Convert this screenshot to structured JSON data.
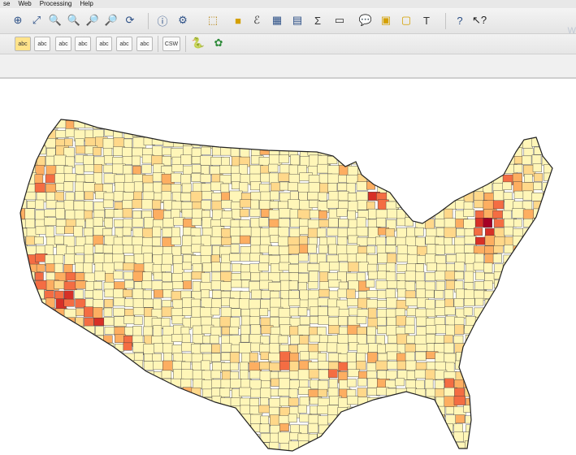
{
  "menu": {
    "items": [
      "se",
      "Web",
      "Processing",
      "Help"
    ]
  },
  "toolbar_main": {
    "buttons": [
      "zoom-1-1-icon",
      "zoom-full-icon",
      "zoom-in-icon",
      "zoom-out-icon",
      "zoom-layer-icon",
      "refresh-icon",
      "identify-icon",
      "pan-icon",
      "select-icon",
      "deselect-icon",
      "expression-icon",
      "attribute-table-icon",
      "field-calculator-icon",
      "statistics-icon",
      "measure-icon",
      "annotation-icon",
      "map-tips-icon",
      "bookmark-icon",
      "text-annotation-icon",
      "help-icon",
      "whats-this-icon"
    ],
    "right_text": "W"
  },
  "toolbar_labels": {
    "buttons": [
      "abc",
      "abc",
      "abc",
      "abc",
      "abc",
      "abc",
      "CSW"
    ],
    "extras": [
      "python-icon",
      "plugin-icon"
    ]
  },
  "map": {
    "theme_colors": [
      "#fff6b8",
      "#ffd88a",
      "#fdae61",
      "#f46d43",
      "#d73027",
      "#a50026"
    ]
  }
}
